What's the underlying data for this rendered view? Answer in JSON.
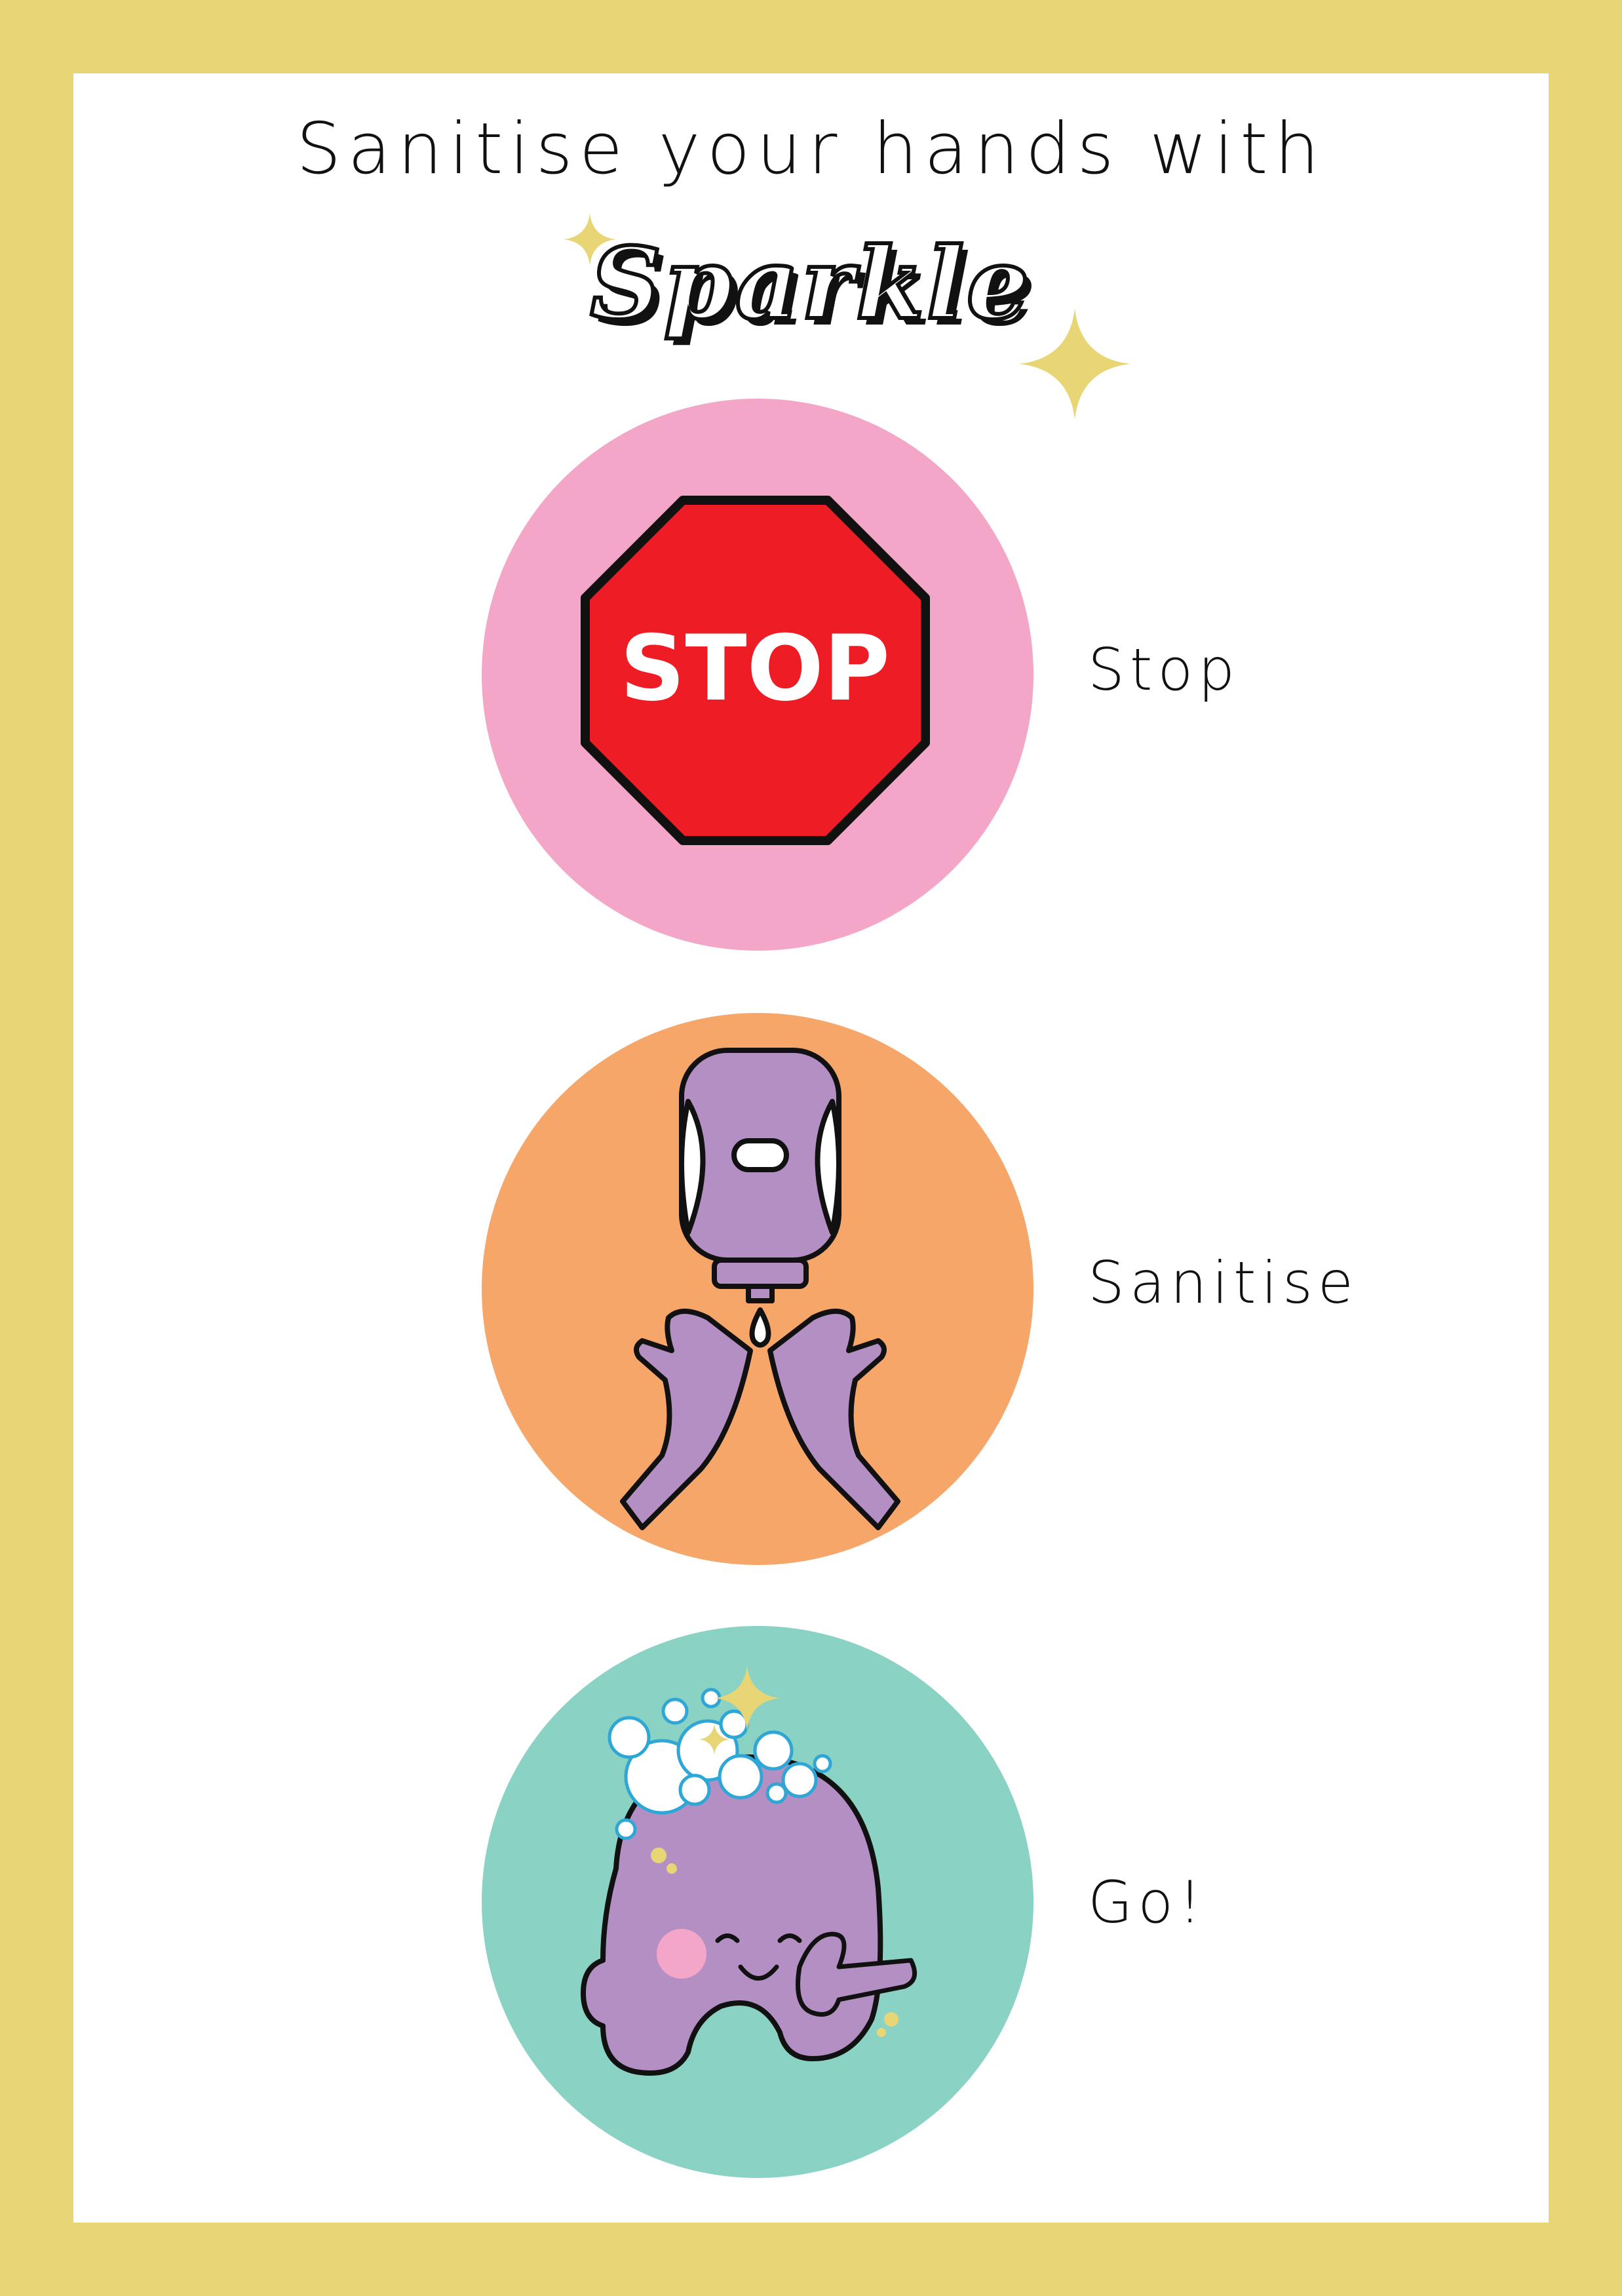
{
  "poster": {
    "headline": "Sanitise your hands with",
    "brand": "Sparkle"
  },
  "steps": [
    {
      "label": "Stop",
      "sign_text": "STOP",
      "icon": "stop-sign-icon",
      "circle_color": "#f4a6c8"
    },
    {
      "label": "Sanitise",
      "icon": "sanitiser-dispenser-hands-icon",
      "circle_color": "#f7a669"
    },
    {
      "label": "Go!",
      "icon": "smiling-character-thumbs-up-icon",
      "circle_color": "#8ad2c4"
    }
  ],
  "colors": {
    "border": "#e8d576",
    "background": "#ffffff",
    "stop_red": "#ee1c25",
    "purple": "#b38fc4",
    "sparkle_gold": "#e8d576"
  }
}
